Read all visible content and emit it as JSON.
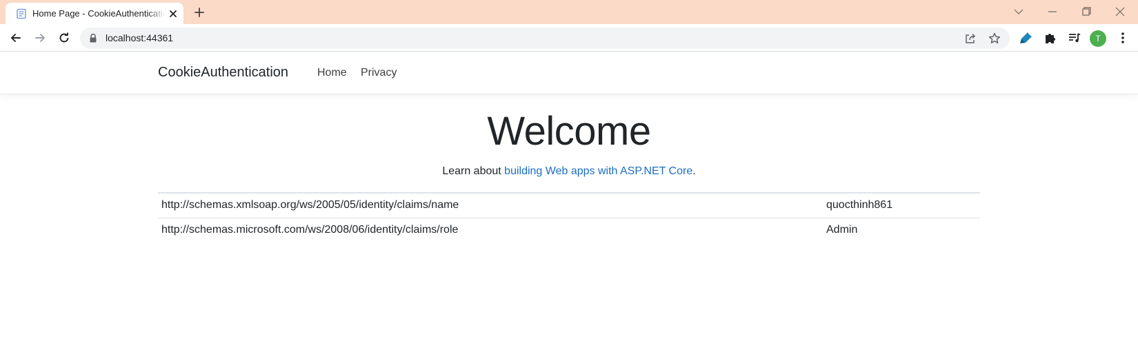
{
  "browser": {
    "tab_title": "Home Page - CookieAuthentication",
    "url": "localhost:44361",
    "profile_initial": "T",
    "colors": {
      "tabstrip": "#fbdac8",
      "avatar": "#4caf50",
      "link": "#1b6ec2"
    }
  },
  "nav": {
    "brand": "CookieAuthentication",
    "links": [
      "Home",
      "Privacy"
    ]
  },
  "main": {
    "heading": "Welcome",
    "learn_prefix": "Learn about ",
    "learn_link": "building Web apps with ASP.NET Core",
    "learn_suffix": "."
  },
  "claims": [
    {
      "type": "http://schemas.xmlsoap.org/ws/2005/05/identity/claims/name",
      "value": "quocthinh861"
    },
    {
      "type": "http://schemas.microsoft.com/ws/2008/06/identity/claims/role",
      "value": "Admin"
    }
  ],
  "icons": {
    "favicon": "page-icon",
    "tab_close": "close-icon",
    "new_tab": "plus-icon",
    "tab_search": "chevron-down-icon",
    "back": "arrow-left-icon",
    "forward": "arrow-right-icon",
    "reload": "reload-icon",
    "lock": "lock-icon",
    "share": "share-icon",
    "bookmark": "star-icon",
    "highlighter": "highlighter-icon",
    "extensions": "puzzle-icon",
    "media": "media-control-icon",
    "menu": "kebab-menu-icon"
  }
}
